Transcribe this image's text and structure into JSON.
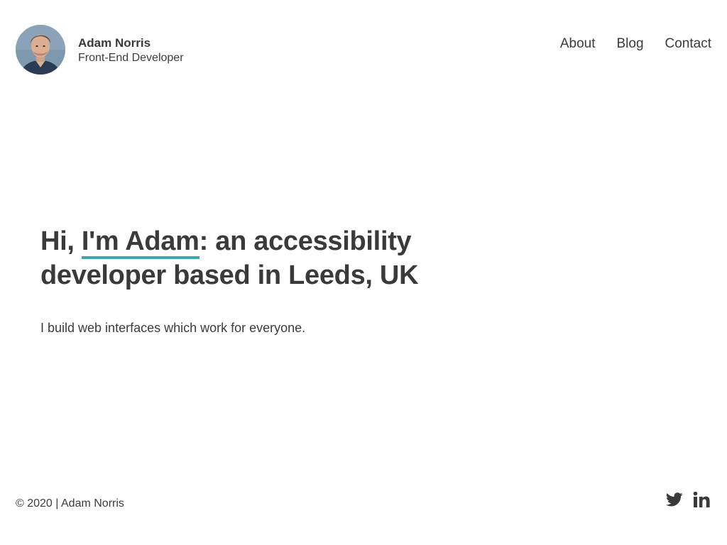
{
  "header": {
    "name": "Adam Norris",
    "role": "Front-End Developer",
    "avatar_icon": "profile-photo",
    "nav": [
      {
        "label": "About"
      },
      {
        "label": "Blog"
      },
      {
        "label": "Contact"
      }
    ]
  },
  "hero": {
    "heading_prefix": "Hi, ",
    "heading_highlight": "I'm Adam",
    "heading_suffix": ": an accessibility developer based in Leeds, UK",
    "subtitle": "I build web interfaces which work for everyone."
  },
  "footer": {
    "copyright": "© 2020 | Adam Norris",
    "social": [
      {
        "icon": "twitter-icon"
      },
      {
        "icon": "linkedin-icon"
      }
    ]
  },
  "colors": {
    "accent": "#3ea8b0",
    "text": "#3c3c3c",
    "background": "#ffffff"
  }
}
